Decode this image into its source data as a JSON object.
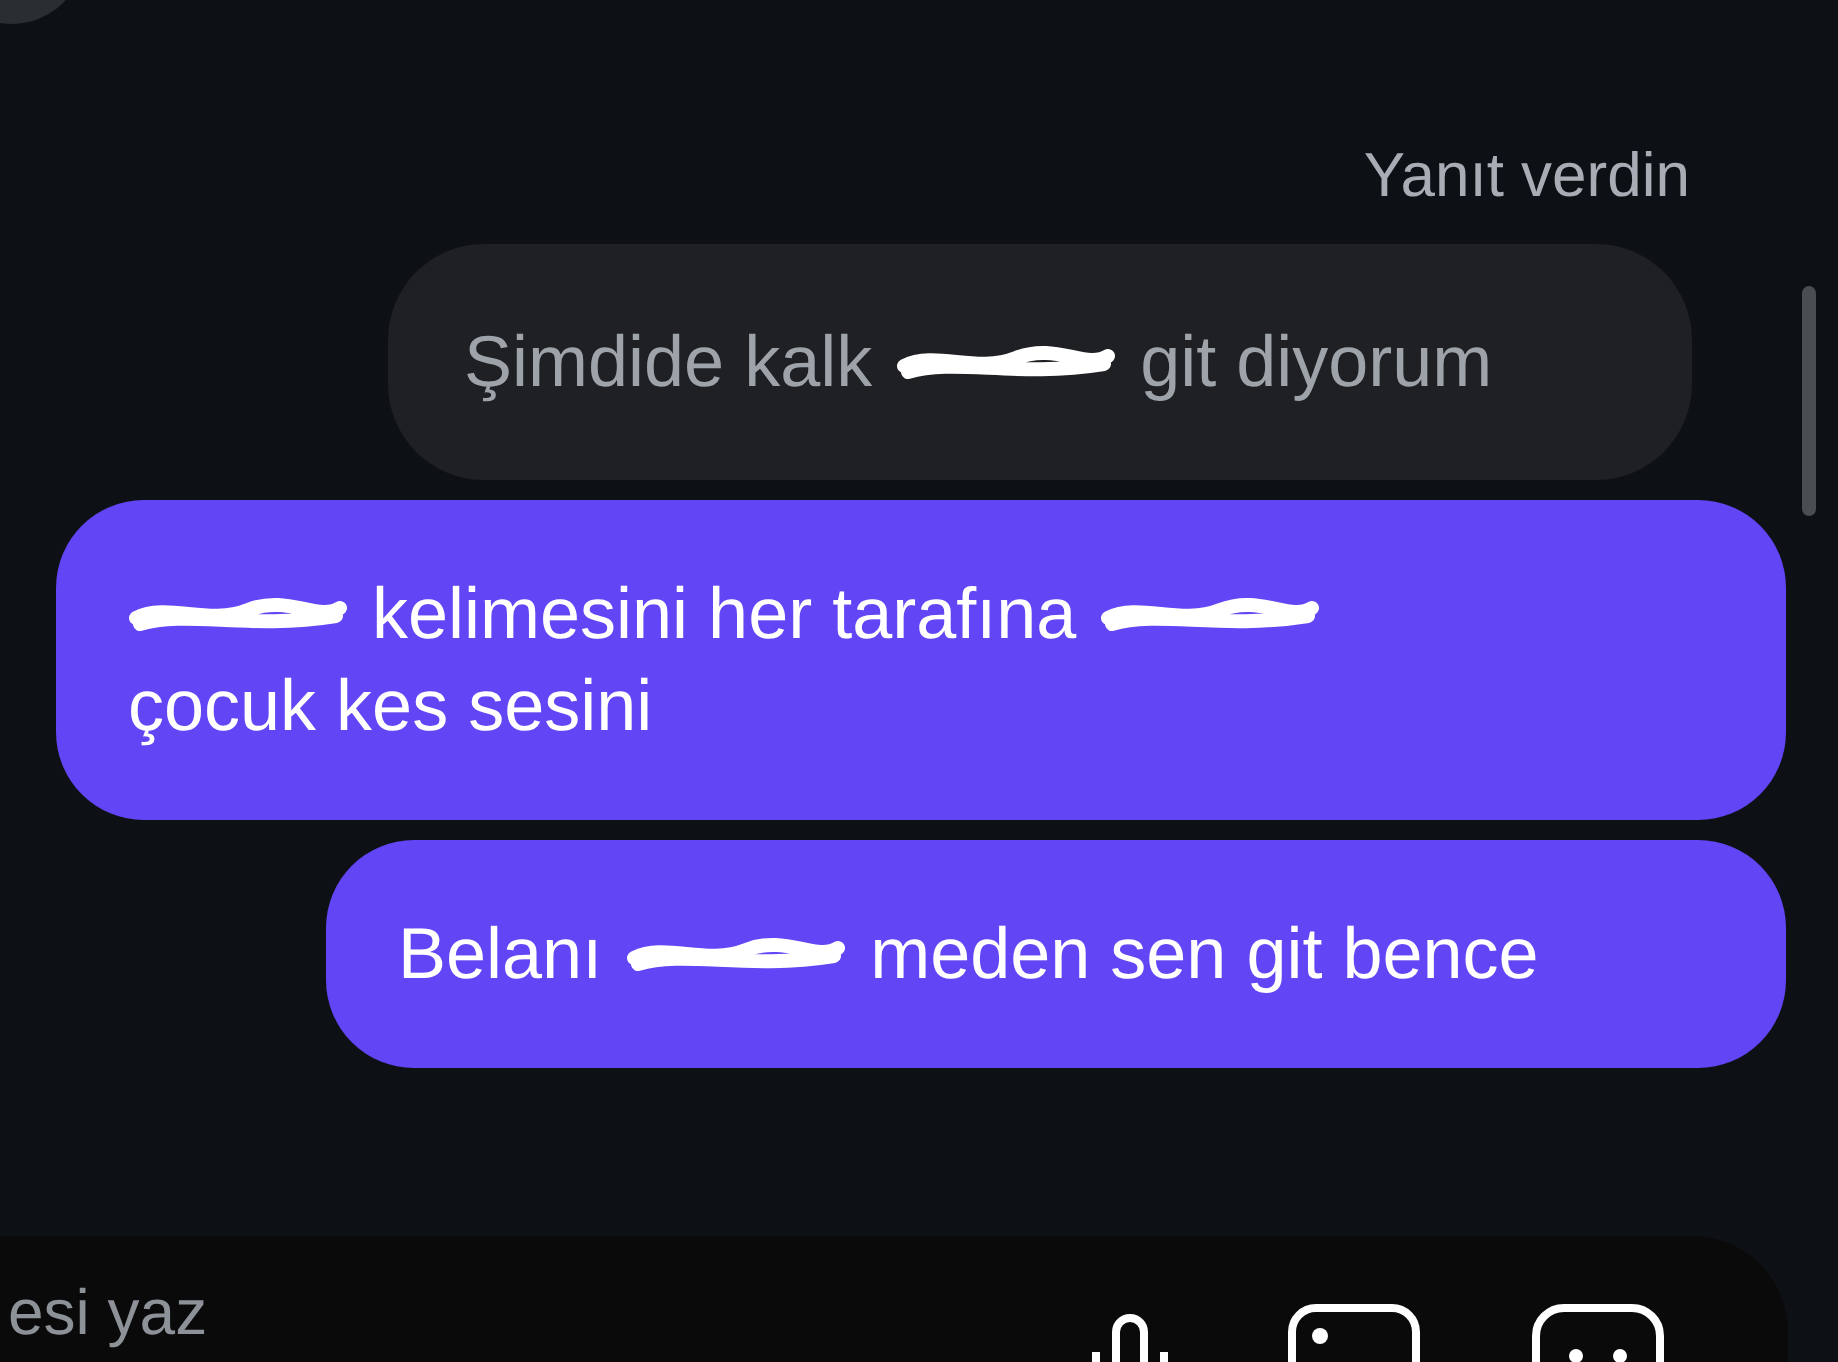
{
  "reply_label": "Yanıt verdin",
  "messages": [
    {
      "kind": "received",
      "parts": [
        {
          "kind": "text",
          "text": "Şimdide kalk"
        },
        {
          "kind": "scribble"
        },
        {
          "kind": "text",
          "text": "git diyorum"
        }
      ]
    },
    {
      "kind": "sent",
      "parts": [
        {
          "kind": "scribble"
        },
        {
          "kind": "text",
          "text": "kelimesini her tarafına"
        },
        {
          "kind": "scribble"
        },
        {
          "kind": "text",
          "text": "çocuk kes sesini"
        }
      ]
    },
    {
      "kind": "sent",
      "parts": [
        {
          "kind": "text",
          "text": "Belanı"
        },
        {
          "kind": "scribble"
        },
        {
          "kind": "text",
          "text": "meden sen git bence"
        }
      ]
    }
  ],
  "composer": {
    "placeholder": "esi yaz"
  }
}
